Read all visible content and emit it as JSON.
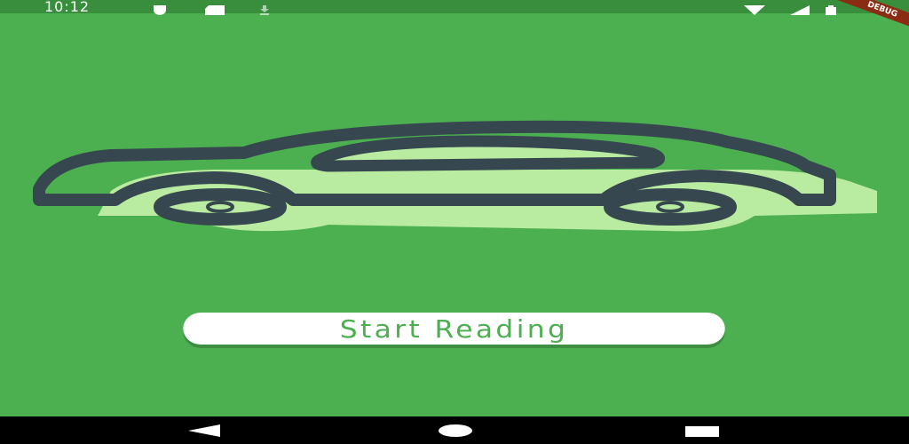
{
  "status_bar": {
    "time": "10:12",
    "icons": [
      "shield-icon",
      "sd-card-icon",
      "download-icon",
      "wifi-icon",
      "signal-icon",
      "battery-icon"
    ],
    "debug_banner": "DEBUG"
  },
  "main": {
    "hero_icon": "car-icon",
    "start_button_label": "Start Reading"
  },
  "nav_bar": {
    "icons": [
      "back-icon",
      "home-icon",
      "recents-icon"
    ]
  },
  "colors": {
    "background": "#4caf50",
    "status_bar": "#388e3c",
    "car_outline": "#37474f",
    "car_shadow": "#b9eba0",
    "button_text": "#4caf50"
  }
}
